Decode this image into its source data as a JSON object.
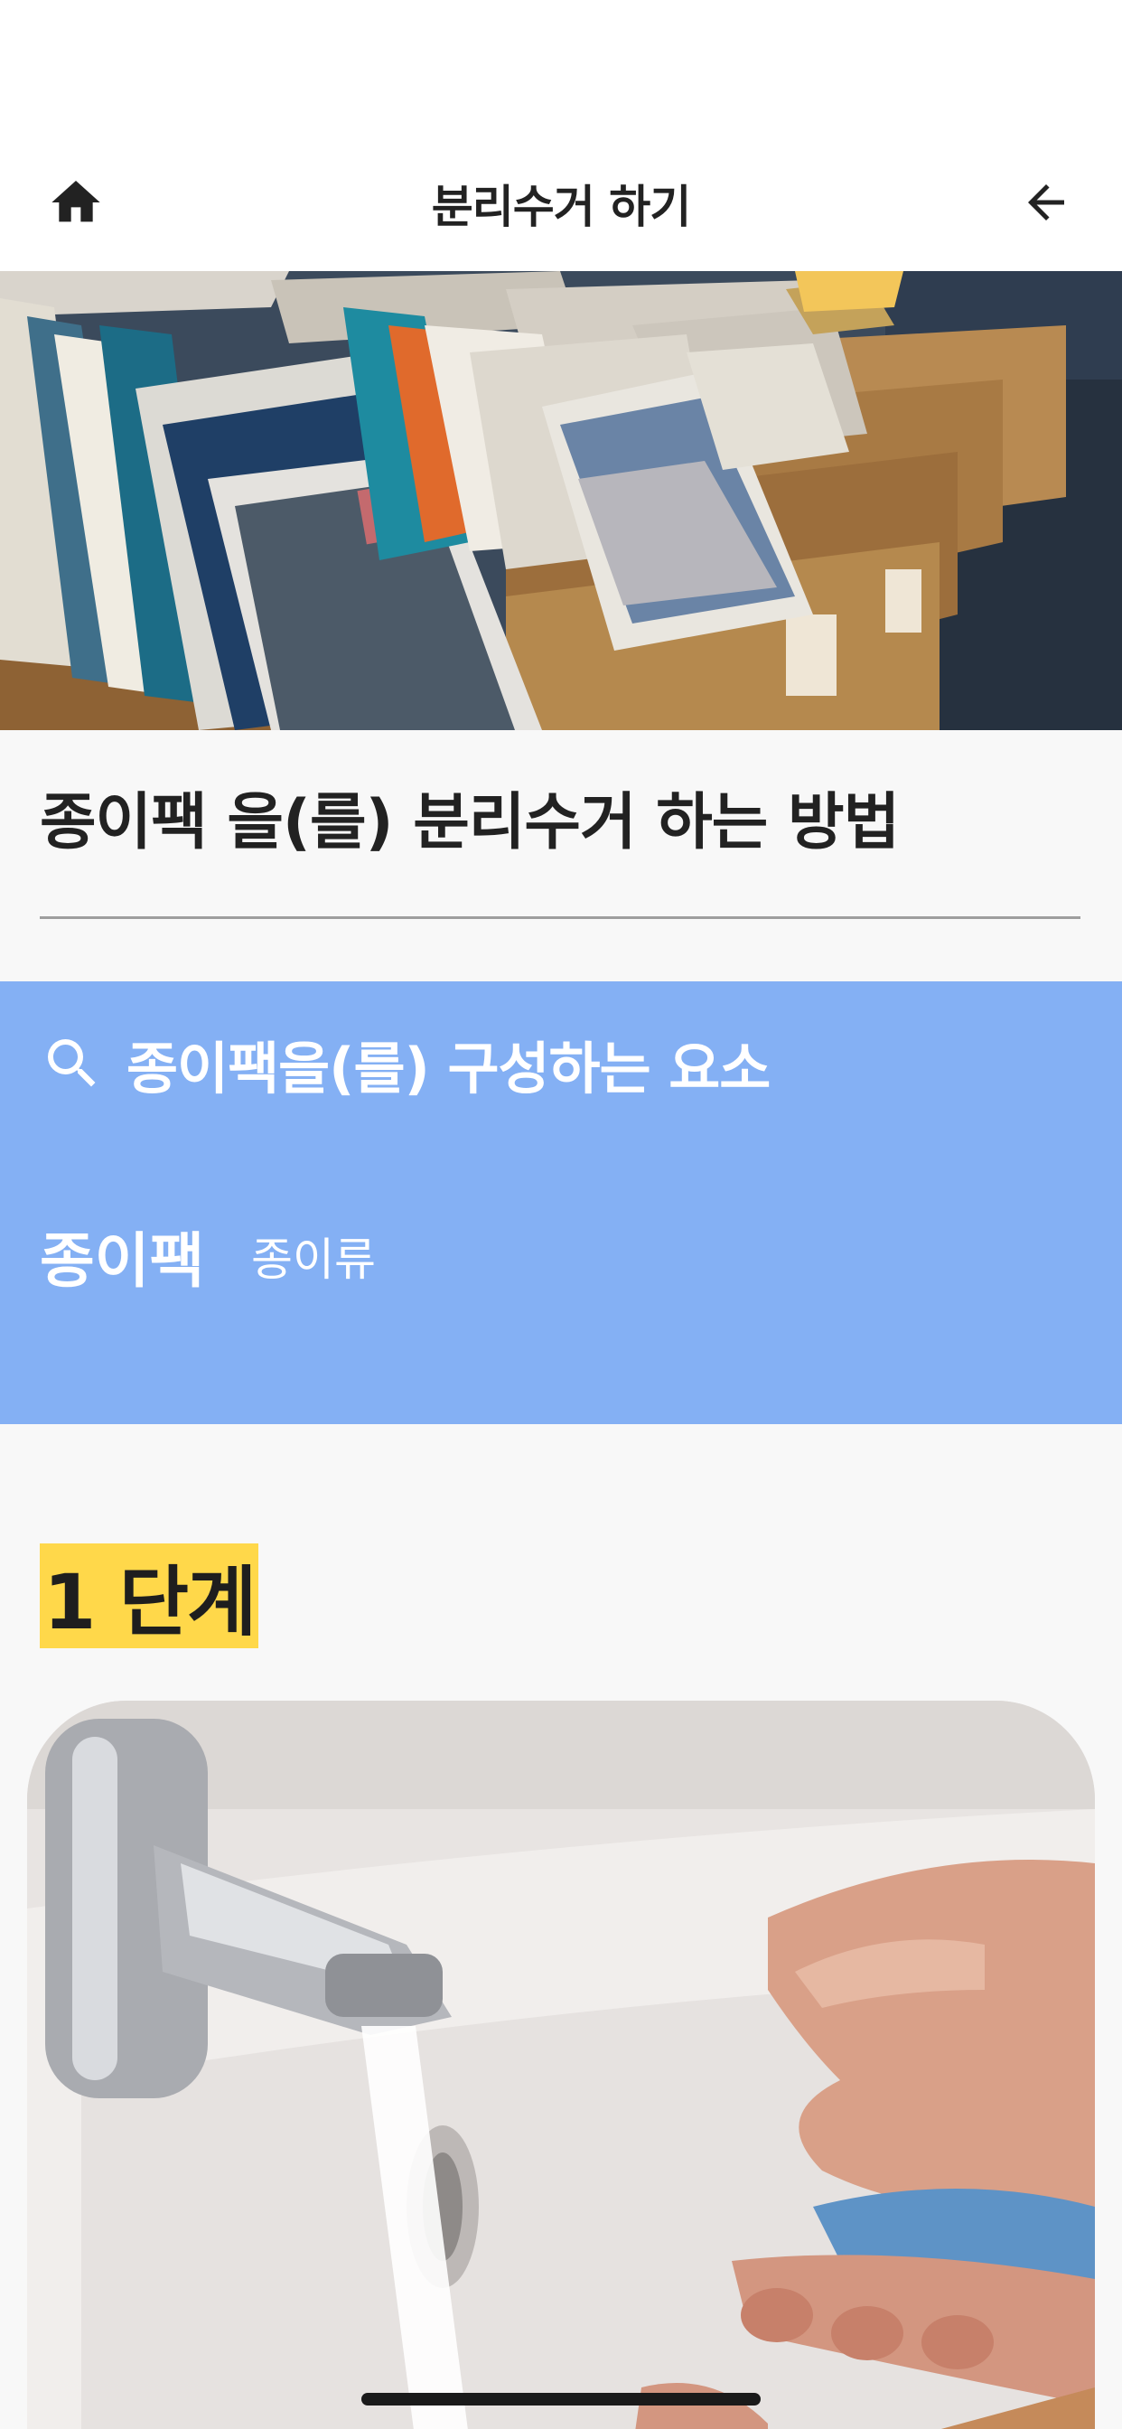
{
  "app_bar": {
    "title": "분리수거 하기",
    "home_icon": "home-icon",
    "back_icon": "arrow-left-icon"
  },
  "hero": {
    "image": "postcards-in-wooden-boxes"
  },
  "title_section": {
    "heading": "종이팩 을(를) 분리수거 하는 방법"
  },
  "components": {
    "icon": "search-icon",
    "label": "종이팩을(를) 구성하는 요소",
    "items": [
      {
        "name": "종이팩",
        "category": "종이류"
      }
    ],
    "background_color": "#84b0f4"
  },
  "steps": [
    {
      "label": "1 단계",
      "image": "washing-hands-under-faucet"
    }
  ],
  "colors": {
    "accent_blue": "#84b0f4",
    "step_highlight": "#ffd84a"
  }
}
